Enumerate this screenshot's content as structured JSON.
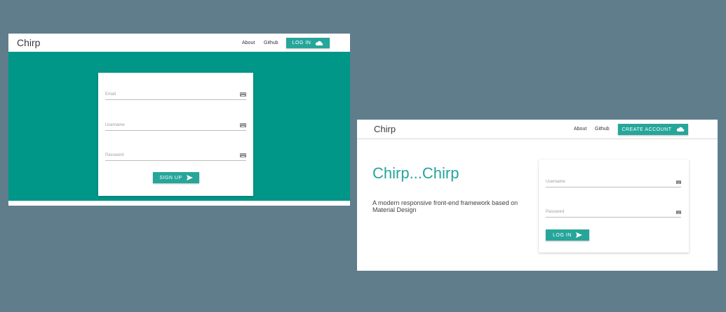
{
  "signup_page": {
    "brand": "Chirp",
    "nav": {
      "about": "About",
      "github": "Github",
      "login_button": "LOG IN"
    },
    "form": {
      "email_placeholder": "Email",
      "username_placeholder": "Username",
      "password_placeholder": "Password",
      "submit_button": "SIGN UP"
    }
  },
  "login_page": {
    "brand": "Chirp",
    "nav": {
      "about": "About",
      "github": "Github",
      "create_button": "CREATE ACCOUNT"
    },
    "hero": {
      "headline": "Chirp...Chirp",
      "tagline": "A modern responsive front-end framework based on Material Design"
    },
    "form": {
      "username_placeholder": "Username",
      "password_placeholder": "Password",
      "submit_button": "LOG IN"
    }
  },
  "colors": {
    "background": "#607d8b",
    "primary": "#009688",
    "accent": "#26a69a"
  },
  "icons": {
    "nav_button": "cloud-icon",
    "submit_button": "send-icon",
    "field_trailing": "keyboard-icon"
  }
}
